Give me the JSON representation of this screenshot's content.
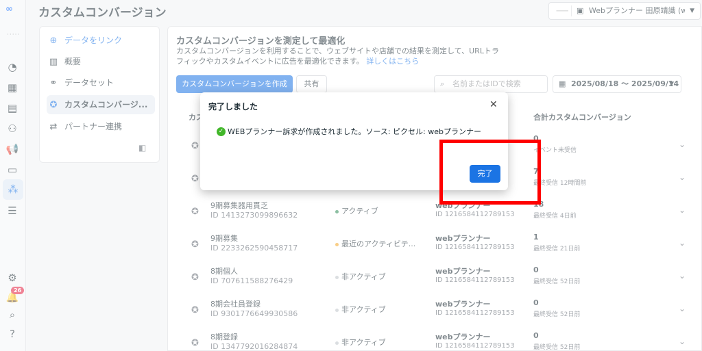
{
  "header": {
    "title": "カスタムコンバージョン",
    "account_label": "Webプランナー 田原靖識 (webプランナ...",
    "account_dash": "⸺"
  },
  "rail": {
    "notifications_count": "26"
  },
  "sidebar": {
    "items": [
      {
        "label": "データをリンク",
        "icon": "plus-circle-icon"
      },
      {
        "label": "概要",
        "icon": "overview-icon"
      },
      {
        "label": "データセット",
        "icon": "dataset-icon"
      },
      {
        "label": "カスタムコンバージ...",
        "icon": "star-badge-icon"
      },
      {
        "label": "パートナー連携",
        "icon": "handshake-icon"
      }
    ]
  },
  "main": {
    "title": "カスタムコンバージョンを測定して最適化",
    "description": "カスタムコンバージョンを利用することで、ウェブサイトや店舗での結果を測定して、URLトラフィックやカスタムイベントに広告を最適化できます。",
    "learn_more": "詳しくはこちら",
    "create_button": "カスタムコンバージョンを作成",
    "share_button": "共有",
    "search_placeholder": "名前またはIDで検索",
    "date_range": "2025/08/18 〜 2025/09/14",
    "columns": {
      "name": "カス",
      "total": "合計カスタムコンバージョン"
    },
    "rows": [
      {
        "name": "",
        "id": "",
        "status": "",
        "pixel": "",
        "pixel_id": "",
        "count": "0",
        "last": "イベント未受信"
      },
      {
        "name": "",
        "id": "",
        "status": "",
        "pixel": "",
        "pixel_id": "",
        "count": "7",
        "last": "最終受信 12時間前"
      },
      {
        "name": "9期募集器用貫乏",
        "id": "ID 1413273099896632",
        "status": "アクティブ",
        "pixel": "webプランナー",
        "pixel_id": "ID 1216584112789153",
        "count": "18",
        "last": "最終受信 4日前"
      },
      {
        "name": "9期募集",
        "id": "ID 2233262590458717",
        "status": "最近のアクティビテ...",
        "pixel": "webプランナー",
        "pixel_id": "ID 1216584112789153",
        "count": "1",
        "last": "最終受信 21日前"
      },
      {
        "name": "8期個人",
        "id": "ID 707611588276429",
        "status": "非アクティブ",
        "pixel": "webプランナー",
        "pixel_id": "ID 1216584112789153",
        "count": "0",
        "last": "最終受信 52日前"
      },
      {
        "name": "8期会社員登録",
        "id": "ID 9301776649930586",
        "status": "非アクティブ",
        "pixel": "webプランナー",
        "pixel_id": "ID 1216584112789153",
        "count": "0",
        "last": "最終受信 52日前"
      },
      {
        "name": "8期登録",
        "id": "ID 1347792016284874",
        "status": "非アクティブ",
        "pixel": "webプランナー",
        "pixel_id": "ID 1216584112789153",
        "count": "0",
        "last": "最終受信 52日前"
      }
    ]
  },
  "modal": {
    "title": "完了しました",
    "message": "WEBプランナー訴求が作成されました。ソース: ピクセル: webプランナー",
    "done_button": "完了"
  },
  "colors": {
    "accent": "#1b74e4",
    "highlight": "#ff0000",
    "status_active": "#2e8b57",
    "status_recent": "#f5a623",
    "status_inactive": "#bec3c9"
  }
}
